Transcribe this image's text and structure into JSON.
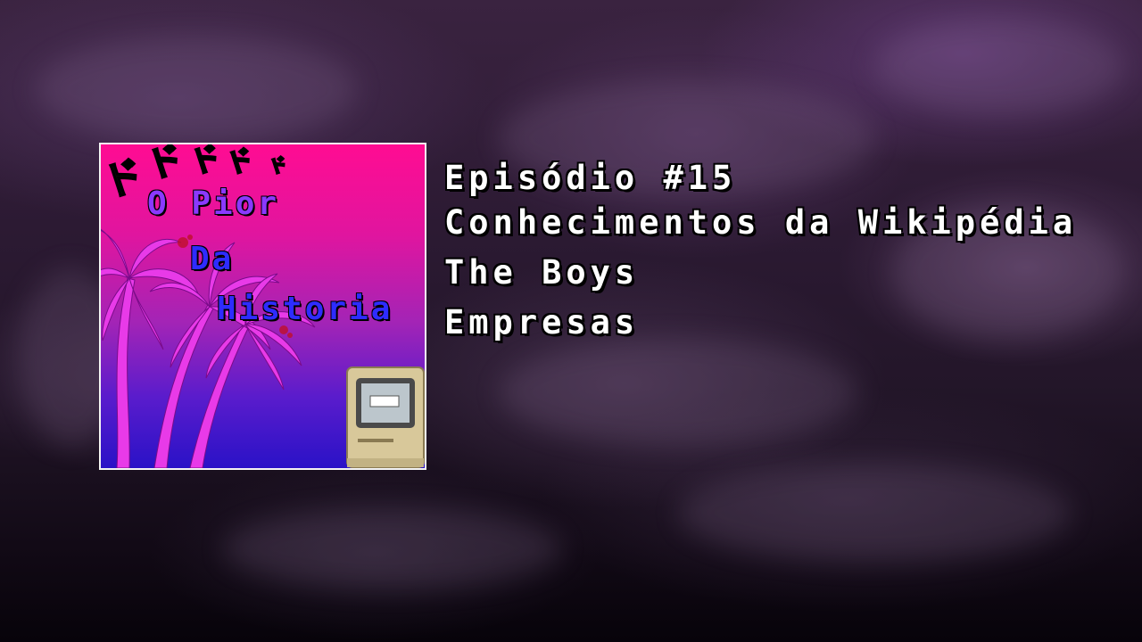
{
  "cover": {
    "title_lines": [
      "O Pior",
      "Da",
      "Historia"
    ],
    "menacing_glyphs": "ドドド"
  },
  "episode": {
    "number_label": "Episódio #15",
    "topics": [
      "Conhecimentos da Wikipédia",
      "The Boys",
      "Empresas"
    ]
  },
  "colors": {
    "cover_top": "#ff0c92",
    "cover_bottom": "#2a12c7",
    "palm": "#e83ae8",
    "title_text": "#ffffff"
  }
}
